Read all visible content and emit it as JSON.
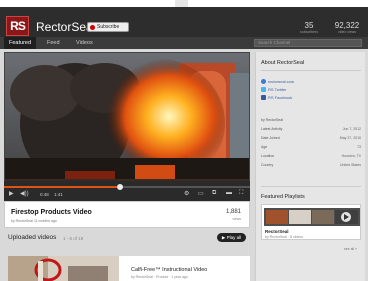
{
  "channel": {
    "logo_text": "RS",
    "name": "RectorSeal",
    "subscribe_label": "Subscribe",
    "stats": [
      {
        "value": "35",
        "label": "subscribers"
      },
      {
        "value": "92,322",
        "label": "video views"
      }
    ]
  },
  "nav": {
    "tabs": [
      {
        "label": "Featured",
        "active": true
      },
      {
        "label": "Feed",
        "active": false
      },
      {
        "label": "Videos",
        "active": false
      }
    ],
    "search_placeholder": "Search Channel"
  },
  "player": {
    "progress": 0.47,
    "current_time": "0:48",
    "duration": "1:41"
  },
  "video": {
    "title": "Firestop Products Video",
    "meta": "by RectorSeal 11 months ago",
    "views": "1,881",
    "views_label": "views"
  },
  "uploads": {
    "heading": "Uploaded videos",
    "count": "1 - 6 of 18",
    "play_all_label": "Play all",
    "items": [
      {
        "title": "Calfi-Free™ Instructional Video",
        "meta": "by RectorSeal · Product · 1 year ago"
      }
    ]
  },
  "sidebar": {
    "about_heading": "About RectorSeal",
    "links": [
      {
        "icon": "globe-icon",
        "label": "rectorseal.com",
        "color": "#3a7bd5"
      },
      {
        "icon": "twitter-icon",
        "label": "RS Twitter",
        "color": "#4ab3f4"
      },
      {
        "icon": "facebook-icon",
        "label": "RS Facebook",
        "color": "#3b5998"
      }
    ],
    "owner_line": "by RectorSeal",
    "details": [
      {
        "label": "Latest Activity",
        "value": "Jun 7, 2012"
      },
      {
        "label": "Date Joined",
        "value": "May 27, 2010"
      },
      {
        "label": "Age",
        "value": "73"
      },
      {
        "label": "Location",
        "value": "Houston, TX"
      },
      {
        "label": "Country",
        "value": "United States"
      }
    ],
    "playlists_heading": "Featured Playlists",
    "playlist": {
      "name": "RectorSeal",
      "meta": "by RectorSeal · 8 videos"
    },
    "see_all": "see all »"
  },
  "colors": {
    "header_bg": "#2d2d2d",
    "logo_red": "#8a1818",
    "progress_red": "#dd5511",
    "link_blue": "#3a5f9e"
  }
}
